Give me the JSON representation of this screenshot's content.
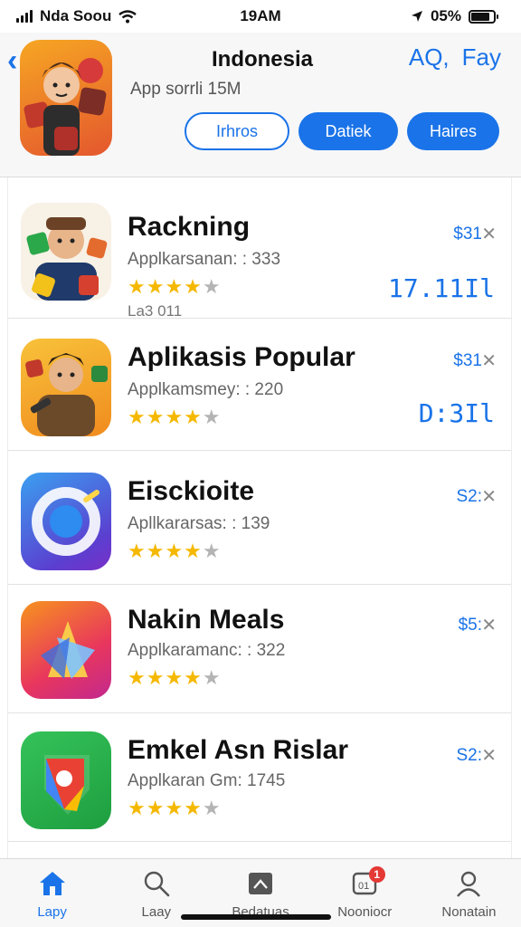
{
  "status_bar": {
    "carrier": "Nda Soou",
    "time": "19AM",
    "battery": "05%",
    "battery_level": 0.85
  },
  "header": {
    "title": "Indonesia",
    "subtitle": "App sorrli 15M",
    "actions": [
      "AQ,",
      "Fay"
    ],
    "buttons": [
      "Irhros",
      "Datiek",
      "Haires"
    ]
  },
  "apps": [
    {
      "name": "Rackning",
      "meta": "Applkarsanan: : 333",
      "stars": "★★★★",
      "stars_off": "★",
      "rating": 4,
      "extra": "La3 011",
      "price": "$31",
      "code": "17.11Il"
    },
    {
      "name": "Aplikasis Popular",
      "meta": "Applkamsmey: : 220",
      "stars": "★★★★",
      "stars_off": "★",
      "rating": 4,
      "extra": "",
      "price": "$31",
      "code": "D:3Il"
    },
    {
      "name": "Eisckioite",
      "meta": "Apllkararsas: : 139",
      "stars": "★★★★",
      "stars_off": "★",
      "rating": 3.5,
      "extra": "",
      "price": "S2:",
      "code": ""
    },
    {
      "name": "Nakin Meals",
      "meta": "Applkaramanc: : 322",
      "stars": "★★★★",
      "stars_off": "★",
      "rating": 3.5,
      "extra": "",
      "price": "$5:",
      "code": ""
    },
    {
      "name": "Emkel Asn Rislar",
      "meta": "Applkaran Gm: 1745",
      "stars": "★★★★",
      "stars_off": "★",
      "rating": 4,
      "extra": "",
      "price": "S2:",
      "code": ""
    }
  ],
  "tabs": [
    {
      "label": "Lapy",
      "icon": "home-icon",
      "active": true
    },
    {
      "label": "Laay",
      "icon": "search-icon",
      "active": false
    },
    {
      "label": "Bedatuas",
      "icon": "grid-icon",
      "active": false
    },
    {
      "label": "Nooniocr",
      "icon": "updates-icon",
      "active": false,
      "badge": "1"
    },
    {
      "label": "Nonatain",
      "icon": "person-icon",
      "active": false
    }
  ],
  "colors": {
    "accent": "#1a73e8",
    "star": "#f5b800",
    "badge": "#e53935"
  }
}
